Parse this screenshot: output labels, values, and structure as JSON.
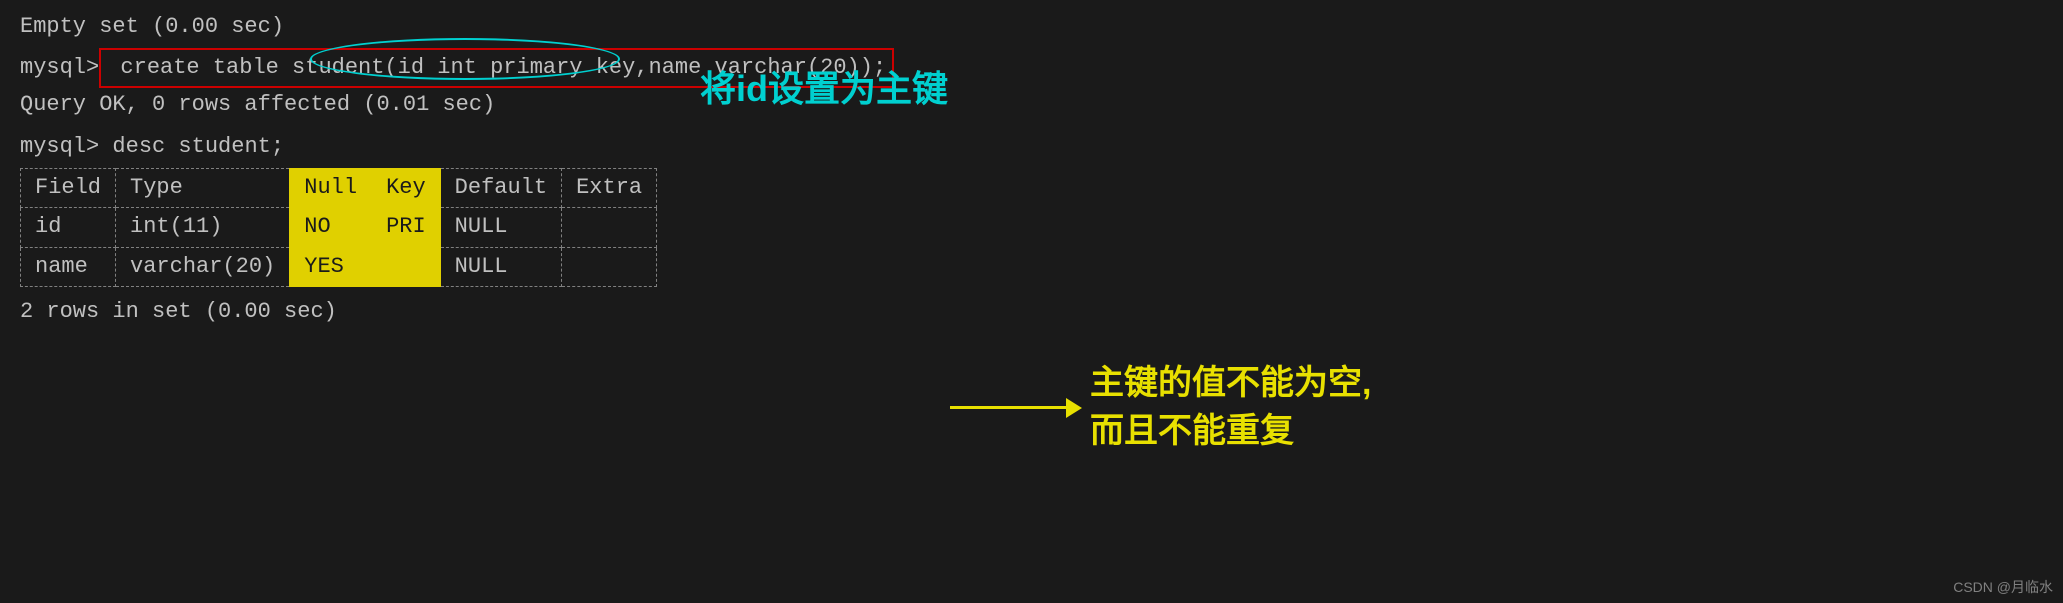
{
  "terminal": {
    "empty_set_line": "Empty set (0.00 sec)",
    "prompt1": "mysql>",
    "command1": " create table student(id int primary key,name varchar(20));",
    "query_ok": "Query OK, 0 rows affected (0.01 sec)",
    "prompt2": "mysql>",
    "command2": " desc student;",
    "table": {
      "headers": [
        "Field",
        "Type",
        "Null",
        "Key",
        "Default",
        "Extra"
      ],
      "rows": [
        [
          "id",
          "int(11)",
          "NO",
          "PRI",
          "NULL",
          ""
        ],
        [
          "name",
          "varchar(20)",
          "YES",
          "",
          "NULL",
          ""
        ]
      ]
    },
    "footer": "2 rows in set (0.00 sec)"
  },
  "annotations": {
    "primary_key_label": "将id设置为主键",
    "null_constraint_line1": "主键的值不能为空,",
    "null_constraint_line2": "而且不能重复"
  },
  "watermark": {
    "text": "CSDN @月临水"
  }
}
